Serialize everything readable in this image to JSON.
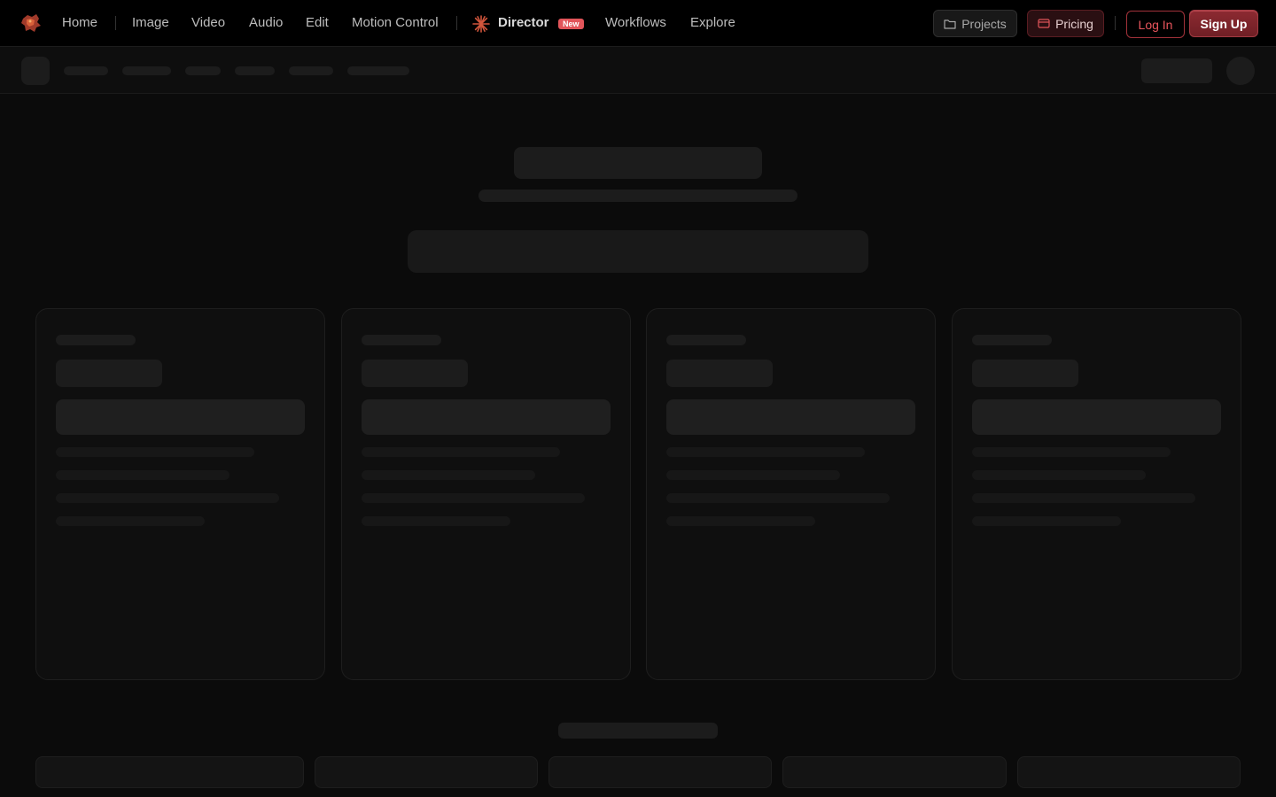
{
  "nav": {
    "logo_icon": "dragon-logo-icon",
    "links": [
      {
        "label": "Home"
      },
      {
        "label": "Image"
      },
      {
        "label": "Video"
      },
      {
        "label": "Audio"
      },
      {
        "label": "Edit"
      },
      {
        "label": "Motion Control"
      }
    ],
    "director": {
      "label": "Director",
      "badge": "New",
      "icon": "sparkle-asterisk-icon"
    },
    "links_right": [
      {
        "label": "Workflows"
      },
      {
        "label": "Explore"
      }
    ],
    "projects_label": "Projects",
    "projects_icon": "folder-icon",
    "pricing_label": "Pricing",
    "pricing_icon": "credit-card-icon",
    "login_label": "Log In",
    "signup_label": "Sign Up"
  },
  "colors": {
    "accent": "#e2555a",
    "background": "#0b0b0b",
    "skeleton": "#1c1c1c"
  }
}
